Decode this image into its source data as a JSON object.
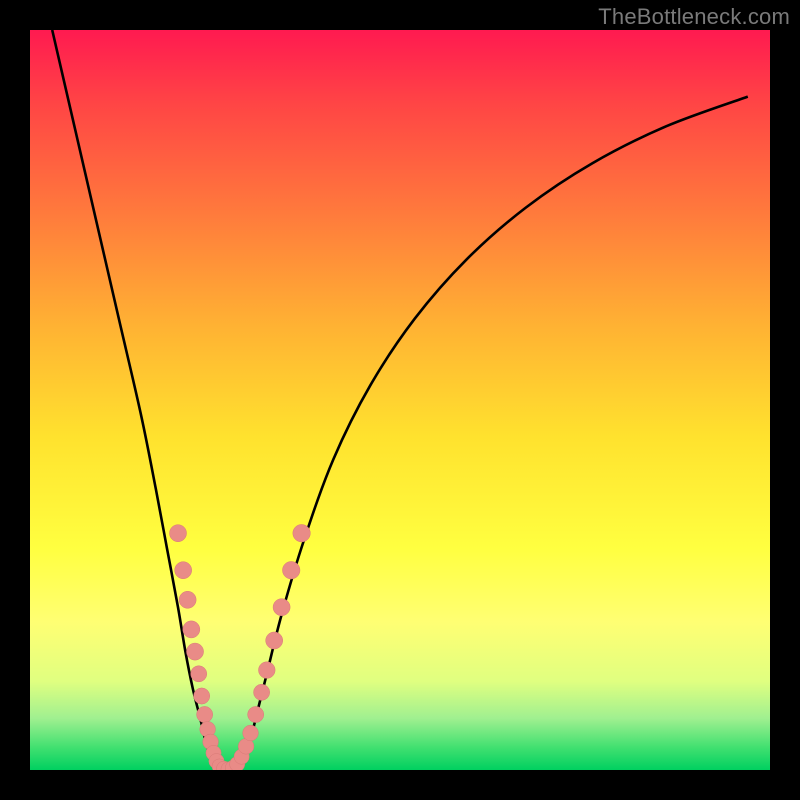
{
  "watermark": "TheBottleneck.com",
  "colors": {
    "curve": "#000000",
    "marker_fill": "#e98b87",
    "marker_stroke": "#d97a77"
  },
  "chart_data": {
    "type": "line",
    "title": "",
    "xlabel": "",
    "ylabel": "",
    "xlim": [
      0,
      100
    ],
    "ylim": [
      0,
      100
    ],
    "grid": false,
    "series": [
      {
        "name": "curve",
        "x": [
          3,
          6,
          9,
          12,
          15,
          17,
          18.5,
          20,
          21,
          22,
          23,
          23.7,
          24.3,
          25,
          25.5,
          26,
          27,
          28,
          29,
          30,
          31,
          32,
          34,
          37,
          41,
          46,
          52,
          59,
          67,
          76,
          86,
          97
        ],
        "y": [
          100,
          87,
          74,
          61,
          48,
          38,
          30,
          22,
          16,
          11,
          7,
          4,
          2,
          0.7,
          0.2,
          0,
          0,
          0.5,
          2,
          5,
          9,
          13,
          21,
          31,
          42,
          52,
          61,
          69,
          76,
          82,
          87,
          91
        ]
      }
    ],
    "markers": [
      {
        "x": 20.0,
        "y": 32,
        "r": 1.6
      },
      {
        "x": 20.7,
        "y": 27,
        "r": 1.6
      },
      {
        "x": 21.3,
        "y": 23,
        "r": 1.6
      },
      {
        "x": 21.8,
        "y": 19,
        "r": 1.6
      },
      {
        "x": 22.3,
        "y": 16,
        "r": 1.6
      },
      {
        "x": 22.8,
        "y": 13,
        "r": 1.4
      },
      {
        "x": 23.2,
        "y": 10,
        "r": 1.4
      },
      {
        "x": 23.6,
        "y": 7.5,
        "r": 1.4
      },
      {
        "x": 24.0,
        "y": 5.5,
        "r": 1.3
      },
      {
        "x": 24.4,
        "y": 3.8,
        "r": 1.3
      },
      {
        "x": 24.8,
        "y": 2.3,
        "r": 1.2
      },
      {
        "x": 25.2,
        "y": 1.2,
        "r": 1.2
      },
      {
        "x": 25.6,
        "y": 0.5,
        "r": 1.1
      },
      {
        "x": 26.2,
        "y": 0.2,
        "r": 1.1
      },
      {
        "x": 26.8,
        "y": 0.1,
        "r": 1.1
      },
      {
        "x": 27.4,
        "y": 0.3,
        "r": 1.1
      },
      {
        "x": 28.0,
        "y": 0.8,
        "r": 1.2
      },
      {
        "x": 28.6,
        "y": 1.8,
        "r": 1.2
      },
      {
        "x": 29.2,
        "y": 3.2,
        "r": 1.3
      },
      {
        "x": 29.8,
        "y": 5.0,
        "r": 1.3
      },
      {
        "x": 30.5,
        "y": 7.5,
        "r": 1.4
      },
      {
        "x": 31.3,
        "y": 10.5,
        "r": 1.4
      },
      {
        "x": 32.0,
        "y": 13.5,
        "r": 1.5
      },
      {
        "x": 33.0,
        "y": 17.5,
        "r": 1.6
      },
      {
        "x": 34.0,
        "y": 22,
        "r": 1.6
      },
      {
        "x": 35.3,
        "y": 27,
        "r": 1.7
      },
      {
        "x": 36.7,
        "y": 32,
        "r": 1.7
      }
    ]
  }
}
